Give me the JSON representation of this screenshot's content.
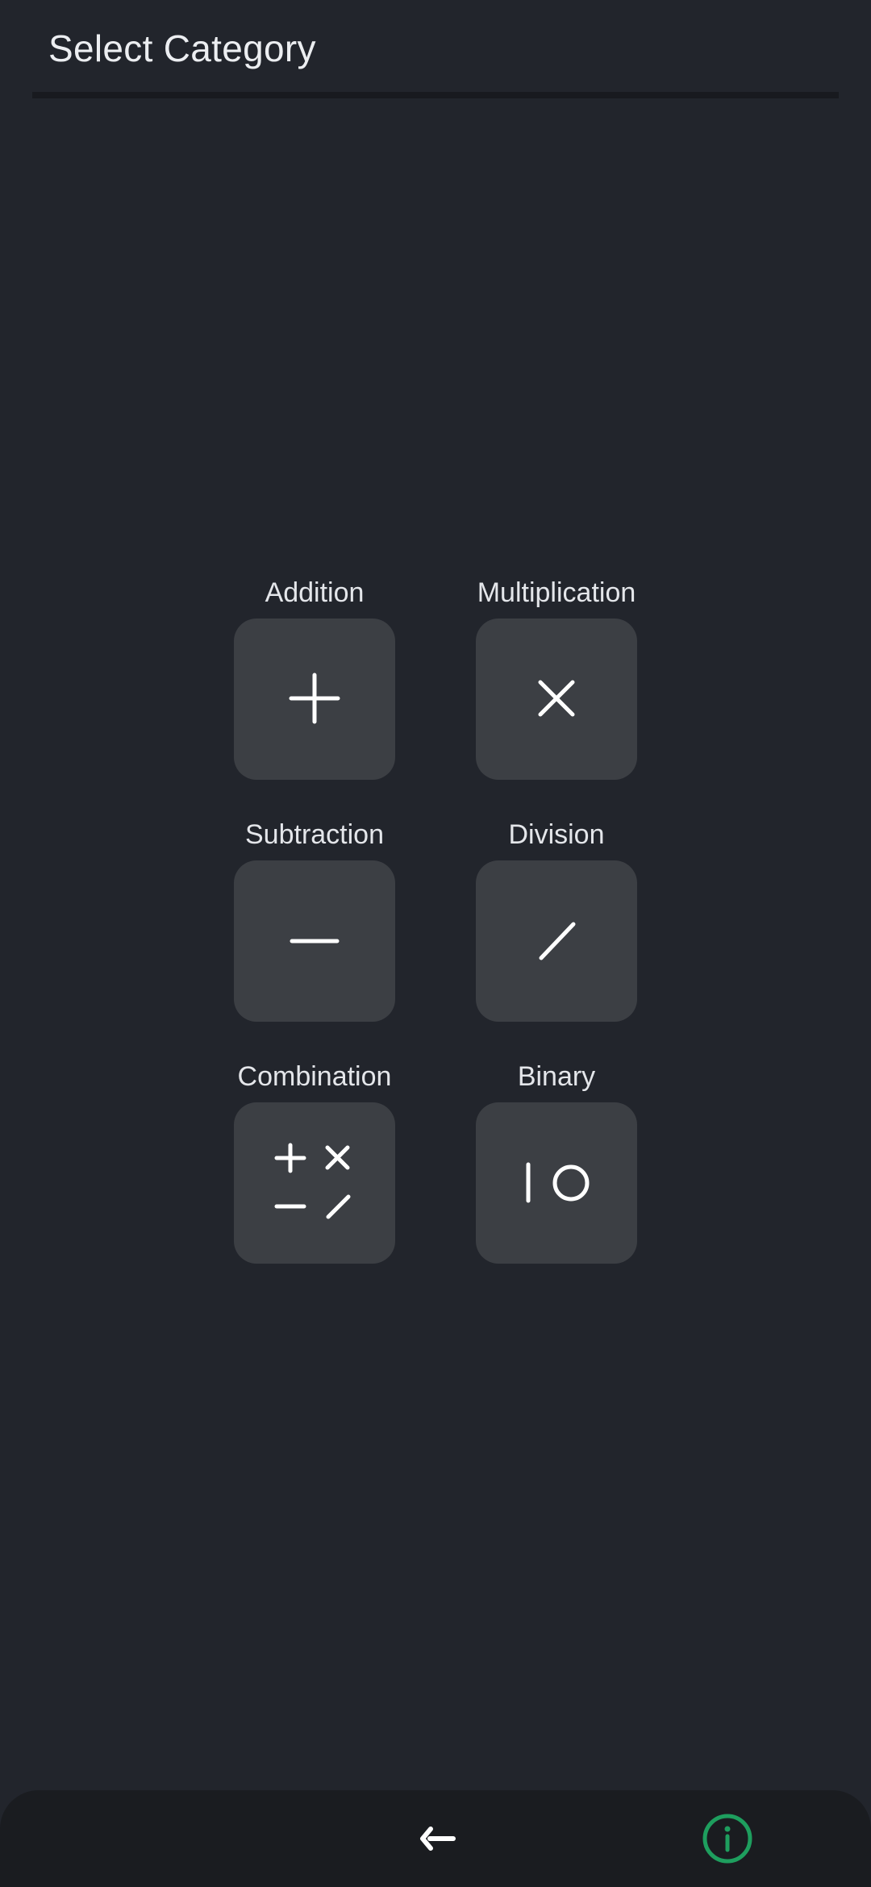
{
  "header": {
    "title": "Select Category"
  },
  "categories": [
    {
      "label": "Addition",
      "icon": "plus-icon"
    },
    {
      "label": "Multiplication",
      "icon": "times-icon"
    },
    {
      "label": "Subtraction",
      "icon": "minus-icon"
    },
    {
      "label": "Division",
      "icon": "slash-icon"
    },
    {
      "label": "Combination",
      "icon": "combination-icon"
    },
    {
      "label": "Binary",
      "icon": "binary-icon"
    }
  ],
  "bottom_nav": {
    "back_icon": "back-arrow-icon",
    "info_icon": "info-icon"
  },
  "colors": {
    "background": "#22252c",
    "tile": "#3c3f44",
    "bottom_bar": "#1a1c20",
    "info_accent": "#1e9e5e"
  }
}
